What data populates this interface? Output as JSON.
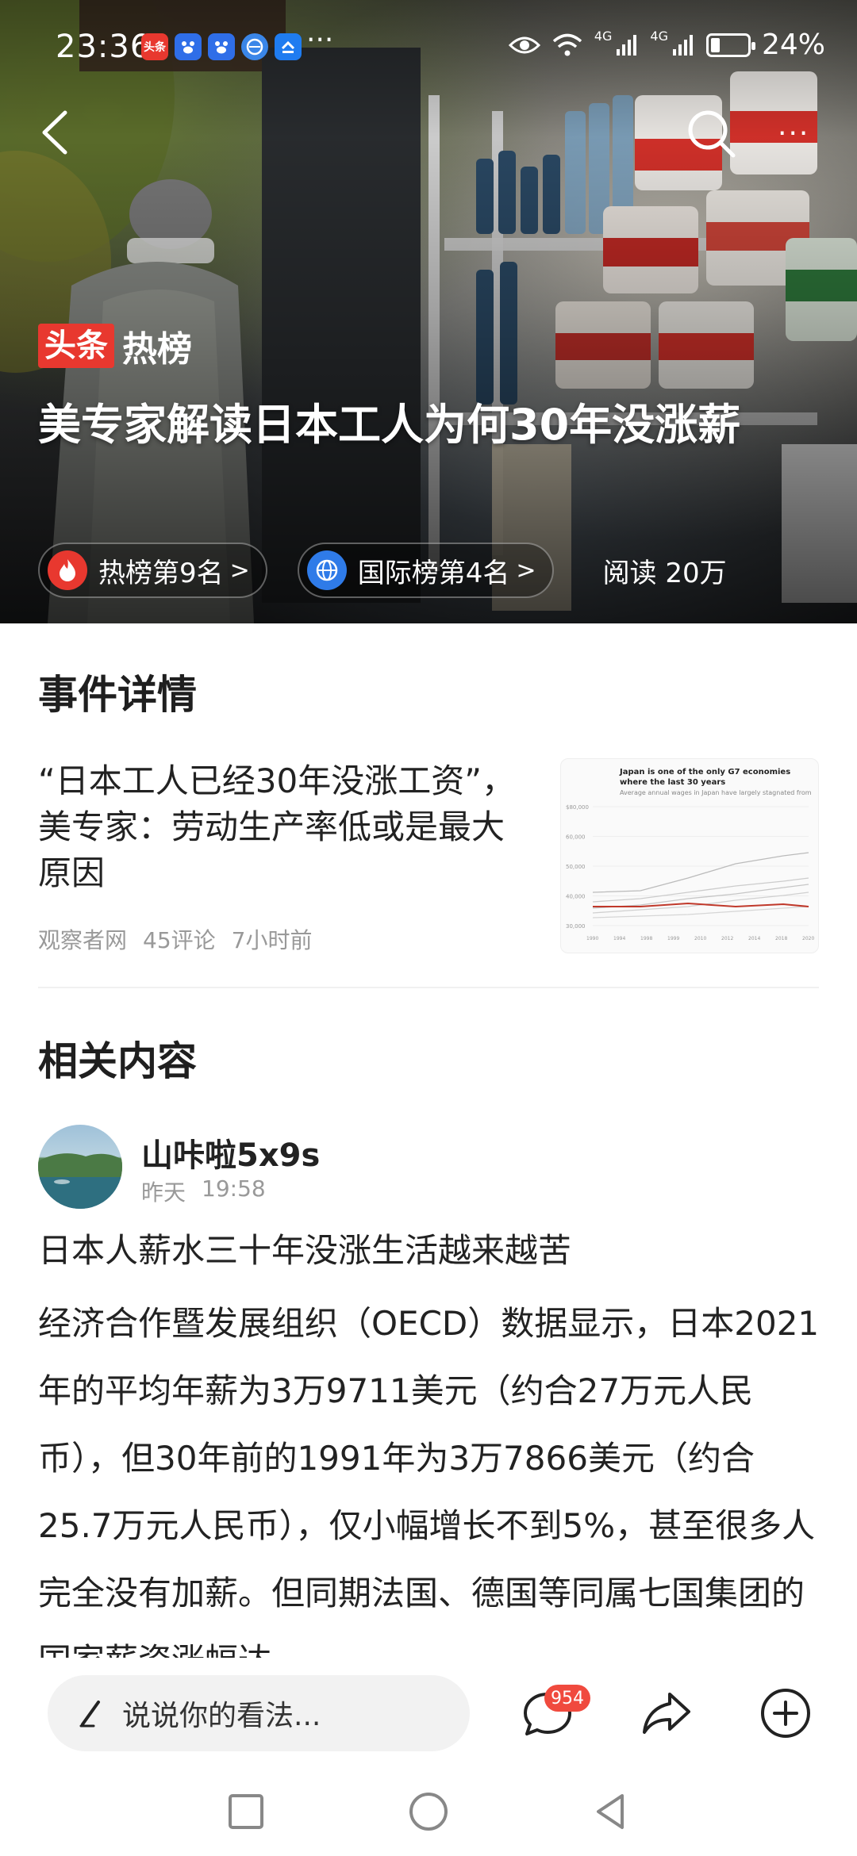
{
  "status_bar": {
    "time": "23:36",
    "app_icons": [
      {
        "name": "toutiao-app-icon",
        "label": "头条",
        "color": "#e8382f"
      },
      {
        "name": "baidu-app-icon",
        "label": "",
        "color": "#2f6ee8"
      },
      {
        "name": "baidu-app-icon-2",
        "label": "",
        "color": "#2f6ee8"
      },
      {
        "name": "browser-app-icon",
        "label": "",
        "color": "#3a86e8"
      },
      {
        "name": "sync-app-icon",
        "label": "",
        "color": "#1f7cf0"
      }
    ],
    "more": "···",
    "network_1": "4G",
    "network_2": "4G",
    "battery_text": "24%",
    "battery_level": 0.24
  },
  "hero": {
    "hot_logo_box": "头条",
    "hot_logo_text": "热榜",
    "title": "美专家解读日本工人为何30年没涨薪",
    "chips": [
      {
        "label": "热榜第9名",
        "icon": "flame-icon",
        "color": "#e8382f"
      },
      {
        "label": "国际榜第4名",
        "icon": "globe-icon",
        "color": "#2f7be8"
      }
    ],
    "read_count": "阅读 20万"
  },
  "event": {
    "section_title": "事件详情",
    "title": "“日本工人已经30年没涨工资”，美专家：劳动生产率低或是最大原因",
    "source": "观察者网",
    "comments": "45评论",
    "time": "7小时前",
    "thumbnail": {
      "title": "Japan is one of the only G7 economies where the last 30 years",
      "subtitle": "Average annual wages in Japan have largely stagnated from",
      "y_ticks": [
        "$80,000",
        "60,000",
        "50,000",
        "40,000",
        "30,000"
      ],
      "x_ticks": [
        "1990",
        "1994",
        "1998",
        "1999",
        "2010",
        "2012",
        "2014",
        "2018",
        "2020"
      ]
    }
  },
  "related": {
    "section_title": "相关内容",
    "author": "山咔啦5x9s",
    "date": "昨天",
    "time": "19:58",
    "post_title": "日本人薪水三十年没涨生活越来越苦",
    "post_text": "经济合作暨发展组织（OECD）数据显示，日本2021年的平均年薪为3万9711美元（约合27万元人民币），但30年前的1991年为3万7866美元（约合25.7万元人民币），仅小幅增长不到5%，甚至很多人完全没有加薪。但同期法国、德国等同属七国集团的国家薪资涨幅达"
  },
  "bottom_bar": {
    "comment_placeholder": "说说你的看法...",
    "comment_count": "954"
  },
  "colors": {
    "accent_red": "#e8382f",
    "accent_blue": "#2f7be8",
    "text_dark": "#222222",
    "text_muted": "#999999"
  }
}
